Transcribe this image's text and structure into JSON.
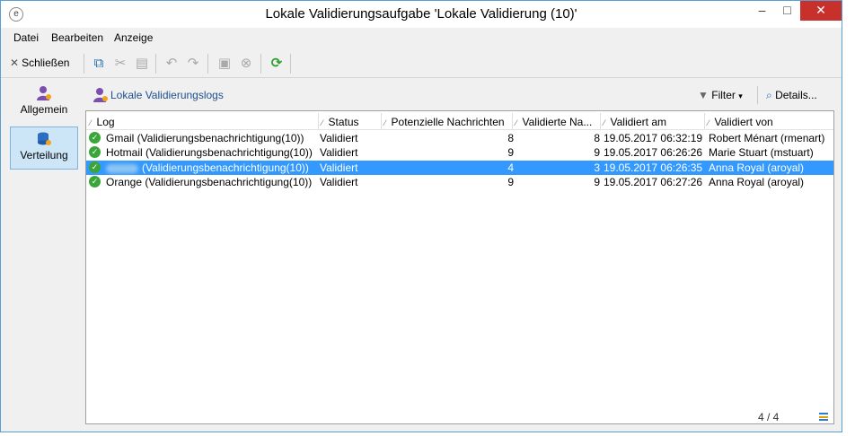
{
  "window": {
    "title": "Lokale Validierungsaufgabe 'Lokale Validierung (10)'",
    "controls": [
      "–",
      "□",
      "✕"
    ]
  },
  "menu": [
    "Datei",
    "Bearbeiten",
    "Anzeige"
  ],
  "toolbar": {
    "close_label": "Schließen",
    "icons": [
      "copy-icon",
      "cut-icon",
      "paste-icon",
      "undo-icon",
      "redo-icon",
      "save-icon",
      "cancel-icon",
      "refresh-icon"
    ]
  },
  "nav": {
    "items": [
      {
        "label": "Allgemein",
        "icon": "user-icon",
        "selected": false
      },
      {
        "label": "Verteilung",
        "icon": "database-icon",
        "selected": true
      }
    ]
  },
  "panel": {
    "title": "Lokale Validierungslogs",
    "filter_label": "Filter",
    "details_label": "Details..."
  },
  "table": {
    "columns": [
      "Log",
      "Status",
      "Potenzielle Nachrichten",
      "Validierte Na...",
      "Validiert am",
      "Validiert von"
    ],
    "rows": [
      {
        "log": "Gmail (Validierungsbenachrichtigung(10))",
        "status": "Validiert",
        "potential": "8",
        "validated": "8",
        "date": "19.05.2017 06:32:19",
        "by": "Robert Ménart (rmenart)",
        "selected": false
      },
      {
        "log": "Hotmail (Validierungsbenachrichtigung(10))",
        "status": "Validiert",
        "potential": "9",
        "validated": "9",
        "date": "19.05.2017 06:26:26",
        "by": "Marie Stuart (mstuart)",
        "selected": false
      },
      {
        "log": "(Validierungsbenachrichtigung(10))",
        "status": "Validiert",
        "potential": "4",
        "validated": "3",
        "date": "19.05.2017 06:26:35",
        "by": "Anna Royal (aroyal)",
        "selected": true
      },
      {
        "log": "Orange (Validierungsbenachrichtigung(10))",
        "status": "Validiert",
        "potential": "9",
        "validated": "9",
        "date": "19.05.2017 06:27:26",
        "by": "Anna Royal (aroyal)",
        "selected": false
      }
    ],
    "count": "4 / 4"
  }
}
